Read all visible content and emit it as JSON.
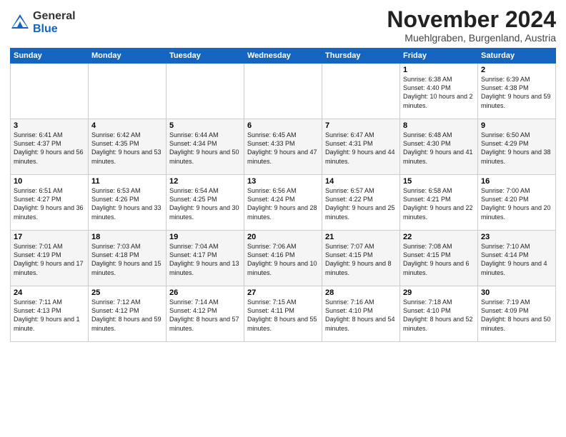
{
  "logo": {
    "general": "General",
    "blue": "Blue"
  },
  "title": {
    "month": "November 2024",
    "location": "Muehlgraben, Burgenland, Austria"
  },
  "headers": [
    "Sunday",
    "Monday",
    "Tuesday",
    "Wednesday",
    "Thursday",
    "Friday",
    "Saturday"
  ],
  "weeks": [
    [
      {
        "day": "",
        "info": ""
      },
      {
        "day": "",
        "info": ""
      },
      {
        "day": "",
        "info": ""
      },
      {
        "day": "",
        "info": ""
      },
      {
        "day": "",
        "info": ""
      },
      {
        "day": "1",
        "info": "Sunrise: 6:38 AM\nSunset: 4:40 PM\nDaylight: 10 hours\nand 2 minutes."
      },
      {
        "day": "2",
        "info": "Sunrise: 6:39 AM\nSunset: 4:38 PM\nDaylight: 9 hours\nand 59 minutes."
      }
    ],
    [
      {
        "day": "3",
        "info": "Sunrise: 6:41 AM\nSunset: 4:37 PM\nDaylight: 9 hours\nand 56 minutes."
      },
      {
        "day": "4",
        "info": "Sunrise: 6:42 AM\nSunset: 4:35 PM\nDaylight: 9 hours\nand 53 minutes."
      },
      {
        "day": "5",
        "info": "Sunrise: 6:44 AM\nSunset: 4:34 PM\nDaylight: 9 hours\nand 50 minutes."
      },
      {
        "day": "6",
        "info": "Sunrise: 6:45 AM\nSunset: 4:33 PM\nDaylight: 9 hours\nand 47 minutes."
      },
      {
        "day": "7",
        "info": "Sunrise: 6:47 AM\nSunset: 4:31 PM\nDaylight: 9 hours\nand 44 minutes."
      },
      {
        "day": "8",
        "info": "Sunrise: 6:48 AM\nSunset: 4:30 PM\nDaylight: 9 hours\nand 41 minutes."
      },
      {
        "day": "9",
        "info": "Sunrise: 6:50 AM\nSunset: 4:29 PM\nDaylight: 9 hours\nand 38 minutes."
      }
    ],
    [
      {
        "day": "10",
        "info": "Sunrise: 6:51 AM\nSunset: 4:27 PM\nDaylight: 9 hours\nand 36 minutes."
      },
      {
        "day": "11",
        "info": "Sunrise: 6:53 AM\nSunset: 4:26 PM\nDaylight: 9 hours\nand 33 minutes."
      },
      {
        "day": "12",
        "info": "Sunrise: 6:54 AM\nSunset: 4:25 PM\nDaylight: 9 hours\nand 30 minutes."
      },
      {
        "day": "13",
        "info": "Sunrise: 6:56 AM\nSunset: 4:24 PM\nDaylight: 9 hours\nand 28 minutes."
      },
      {
        "day": "14",
        "info": "Sunrise: 6:57 AM\nSunset: 4:22 PM\nDaylight: 9 hours\nand 25 minutes."
      },
      {
        "day": "15",
        "info": "Sunrise: 6:58 AM\nSunset: 4:21 PM\nDaylight: 9 hours\nand 22 minutes."
      },
      {
        "day": "16",
        "info": "Sunrise: 7:00 AM\nSunset: 4:20 PM\nDaylight: 9 hours\nand 20 minutes."
      }
    ],
    [
      {
        "day": "17",
        "info": "Sunrise: 7:01 AM\nSunset: 4:19 PM\nDaylight: 9 hours\nand 17 minutes."
      },
      {
        "day": "18",
        "info": "Sunrise: 7:03 AM\nSunset: 4:18 PM\nDaylight: 9 hours\nand 15 minutes."
      },
      {
        "day": "19",
        "info": "Sunrise: 7:04 AM\nSunset: 4:17 PM\nDaylight: 9 hours\nand 13 minutes."
      },
      {
        "day": "20",
        "info": "Sunrise: 7:06 AM\nSunset: 4:16 PM\nDaylight: 9 hours\nand 10 minutes."
      },
      {
        "day": "21",
        "info": "Sunrise: 7:07 AM\nSunset: 4:15 PM\nDaylight: 9 hours\nand 8 minutes."
      },
      {
        "day": "22",
        "info": "Sunrise: 7:08 AM\nSunset: 4:15 PM\nDaylight: 9 hours\nand 6 minutes."
      },
      {
        "day": "23",
        "info": "Sunrise: 7:10 AM\nSunset: 4:14 PM\nDaylight: 9 hours\nand 4 minutes."
      }
    ],
    [
      {
        "day": "24",
        "info": "Sunrise: 7:11 AM\nSunset: 4:13 PM\nDaylight: 9 hours\nand 1 minute."
      },
      {
        "day": "25",
        "info": "Sunrise: 7:12 AM\nSunset: 4:12 PM\nDaylight: 8 hours\nand 59 minutes."
      },
      {
        "day": "26",
        "info": "Sunrise: 7:14 AM\nSunset: 4:12 PM\nDaylight: 8 hours\nand 57 minutes."
      },
      {
        "day": "27",
        "info": "Sunrise: 7:15 AM\nSunset: 4:11 PM\nDaylight: 8 hours\nand 55 minutes."
      },
      {
        "day": "28",
        "info": "Sunrise: 7:16 AM\nSunset: 4:10 PM\nDaylight: 8 hours\nand 54 minutes."
      },
      {
        "day": "29",
        "info": "Sunrise: 7:18 AM\nSunset: 4:10 PM\nDaylight: 8 hours\nand 52 minutes."
      },
      {
        "day": "30",
        "info": "Sunrise: 7:19 AM\nSunset: 4:09 PM\nDaylight: 8 hours\nand 50 minutes."
      }
    ]
  ]
}
